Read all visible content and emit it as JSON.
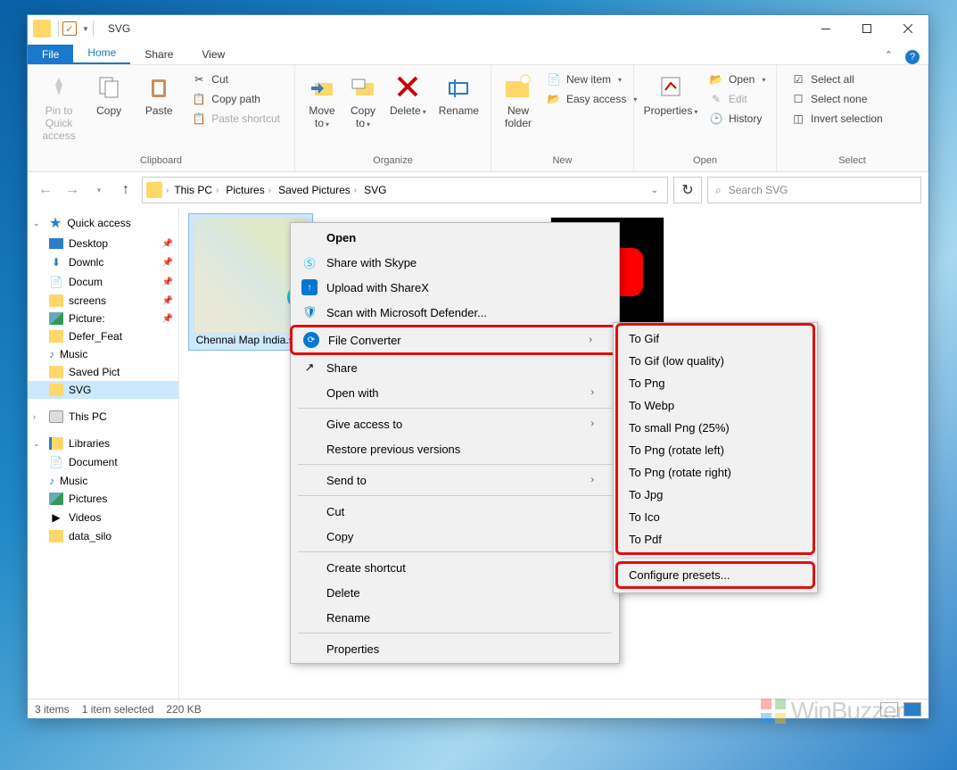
{
  "titlebar": {
    "title": "SVG"
  },
  "tabs": {
    "file": "File",
    "home": "Home",
    "share": "Share",
    "view": "View"
  },
  "ribbon": {
    "clipboard": {
      "label": "Clipboard",
      "pin": "Pin to Quick access",
      "copy": "Copy",
      "paste": "Paste",
      "cut": "Cut",
      "copypath": "Copy path",
      "pasteshortcut": "Paste shortcut"
    },
    "organize": {
      "label": "Organize",
      "moveto": "Move to",
      "copyto": "Copy to",
      "delete": "Delete",
      "rename": "Rename"
    },
    "new": {
      "label": "New",
      "newfolder": "New folder",
      "newitem": "New item",
      "easyaccess": "Easy access"
    },
    "open": {
      "label": "Open",
      "properties": "Properties",
      "open": "Open",
      "edit": "Edit",
      "history": "History"
    },
    "select": {
      "label": "Select",
      "selectall": "Select all",
      "selectnone": "Select none",
      "invert": "Invert selection"
    }
  },
  "breadcrumb": {
    "items": [
      "This PC",
      "Pictures",
      "Saved Pictures",
      "SVG"
    ]
  },
  "search": {
    "placeholder": "Search SVG"
  },
  "sidebar": {
    "quick": "Quick access",
    "desktop": "Desktop",
    "downloads": "Downlc",
    "documents": "Docum",
    "screens": "screens",
    "pictures": "Picture:",
    "defer": "Defer_Feat",
    "music": "Music",
    "savedpict": "Saved Pict",
    "svg": "SVG",
    "thispc": "This PC",
    "libraries": "Libraries",
    "lib_documents": "Document",
    "lib_music": "Music",
    "lib_pictures": "Pictures",
    "lib_videos": "Videos",
    "lib_data": "data_silo"
  },
  "files": {
    "chennai": "Chennai Map India.svg"
  },
  "context1": {
    "open": "Open",
    "skype": "Share with Skype",
    "sharex": "Upload with ShareX",
    "defender": "Scan with Microsoft Defender...",
    "fileconverter": "File Converter",
    "share": "Share",
    "openwith": "Open with",
    "giveaccess": "Give access to",
    "restore": "Restore previous versions",
    "sendto": "Send to",
    "cut": "Cut",
    "copy": "Copy",
    "shortcut": "Create shortcut",
    "delete": "Delete",
    "rename": "Rename",
    "properties": "Properties"
  },
  "context2": {
    "togif": "To Gif",
    "togiflow": "To Gif (low quality)",
    "topng": "To Png",
    "towebp": "To Webp",
    "tosmallpng": "To small Png (25%)",
    "topngrotleft": "To Png (rotate left)",
    "topngrotright": "To Png (rotate right)",
    "tojpg": "To Jpg",
    "toico": "To Ico",
    "topdf": "To Pdf",
    "configure": "Configure presets..."
  },
  "status": {
    "count": "3 items",
    "selected": "1 item selected",
    "size": "220 KB"
  },
  "watermark": "WinBuzzer"
}
